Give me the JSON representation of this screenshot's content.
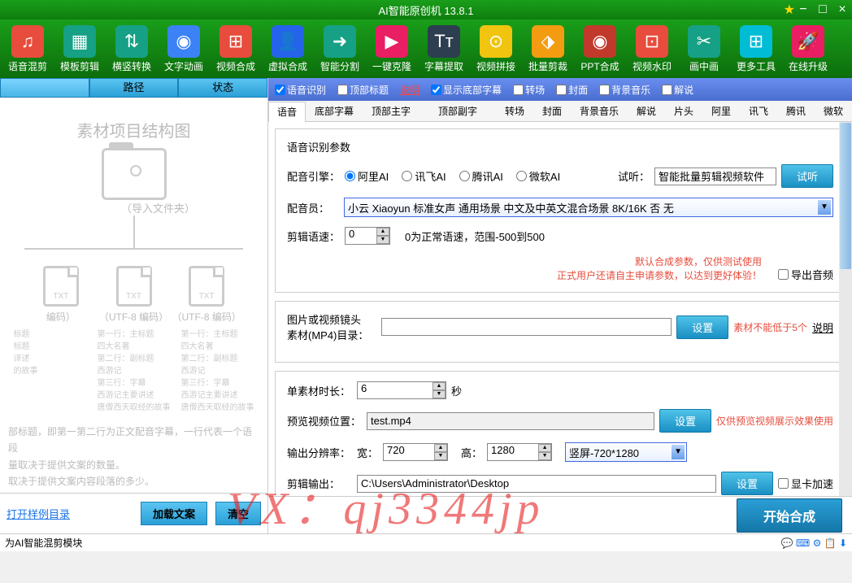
{
  "titlebar": {
    "title": "AI智能原创机 13.8.1"
  },
  "toolbar": [
    {
      "label": "语音混剪",
      "icon": "♫",
      "cls": "ic-red"
    },
    {
      "label": "模板剪辑",
      "icon": "▦",
      "cls": "ic-teal"
    },
    {
      "label": "横竖转换",
      "icon": "⇅",
      "cls": "ic-teal"
    },
    {
      "label": "文字动画",
      "icon": "◉",
      "cls": "ic-blue"
    },
    {
      "label": "视频合成",
      "icon": "⊞",
      "cls": "ic-red"
    },
    {
      "label": "虚拟合成",
      "icon": "👤",
      "cls": "ic-dblue"
    },
    {
      "label": "智能分割",
      "icon": "➜",
      "cls": "ic-teal"
    },
    {
      "label": "一键克隆",
      "icon": "▶",
      "cls": "ic-mag"
    },
    {
      "label": "字幕提取",
      "icon": "Tᴛ",
      "cls": "ic-dark"
    },
    {
      "label": "视频拼接",
      "icon": "⊙",
      "cls": "ic-yellow"
    },
    {
      "label": "批量剪裁",
      "icon": "⬗",
      "cls": "ic-orange"
    },
    {
      "label": "PPT合成",
      "icon": "◉",
      "cls": "ic-dred"
    },
    {
      "label": "视频水印",
      "icon": "⊡",
      "cls": "ic-red"
    },
    {
      "label": "画中画",
      "icon": "✂",
      "cls": "ic-teal"
    },
    {
      "label": "更多工具",
      "icon": "⊞",
      "cls": "ic-cyan"
    },
    {
      "label": "在线升级",
      "icon": "🚀",
      "cls": "ic-mag"
    }
  ],
  "left": {
    "tabs": [
      "",
      "路径",
      "状态"
    ],
    "diag_title": "素材项目结构图",
    "diag_import": "（导入文件夹）",
    "txt": "TXT",
    "enc": [
      "编码）",
      "（UTF-8 编码）",
      "（UTF-8 编码）"
    ],
    "samples": [
      [
        "标题",
        "第一行：主标题",
        "第一行：主标题"
      ],
      [
        "标题",
        "四大名著",
        "四大名著"
      ],
      [
        "",
        "第二行：副标题",
        "第二行：副标题"
      ],
      [
        "",
        "西游记",
        "西游记"
      ],
      [
        "译述",
        "第三行：字幕",
        "第三行：字幕"
      ],
      [
        "",
        "西游记主要讲述",
        "西游记主要讲述"
      ],
      [
        "的故事",
        "唐僧西天取经的故事",
        "唐僧西天取经的故事"
      ]
    ],
    "desc": [
      "部标题，即第一第二行为正文配音字幕，一行代表一个语段",
      "量取决于提供文案的数量。",
      "取决于提供文案内容段落的多少。"
    ],
    "open_sample": "打开样例目录",
    "load": "加载文案",
    "clear": "清空"
  },
  "opts": [
    {
      "label": "语音识别",
      "checked": true
    },
    {
      "label": "顶部标题",
      "checked": false,
      "link": "说明"
    },
    {
      "label": "显示底部字幕",
      "checked": true
    },
    {
      "label": "转场",
      "checked": false
    },
    {
      "label": "封面",
      "checked": false
    },
    {
      "label": "背景音乐",
      "checked": false
    },
    {
      "label": "解说",
      "checked": false
    }
  ],
  "subtabs": [
    "语音",
    "底部字幕",
    "顶部主字幕",
    "顶部副字幕",
    "转场",
    "封面",
    "背景音乐",
    "解说",
    "片头",
    "阿里",
    "讯飞",
    "腾讯",
    "微软"
  ],
  "voice": {
    "section_title": "语音识别参数",
    "engine_label": "配音引擎：",
    "engines": [
      "阿里AI",
      "讯飞AI",
      "腾讯AI",
      "微软AI"
    ],
    "engine_selected": 0,
    "try_label": "试听：",
    "try_value": "智能批量剪辑视频软件",
    "try_btn": "试听",
    "actor_label": "配音员：",
    "actor_value": "小云 Xiaoyun 标准女声 通用场景 中文及中英文混合场景 8K/16K 否 无",
    "speed_label": "剪辑语速：",
    "speed_value": "0",
    "speed_note": "0为正常语速，范围-500到500",
    "warn1": "默认合成参数，仅供测试使用",
    "warn2": "正式用户还请自主申请参数，以达到更好体验！",
    "export_audio": "导出音频"
  },
  "material": {
    "dir_label1": "图片或视频镜头",
    "dir_label2": "素材(MP4)目录：",
    "set_btn": "设置",
    "min_note": "素材不能低于5个",
    "desc_link": "说明",
    "single_label": "单素材时长：",
    "single_value": "6",
    "single_unit": "秒",
    "preview_label": "预览视频位置：",
    "preview_value": "test.mp4",
    "preview_note": "仅供预览视频展示效果使用",
    "res_label": "输出分辨率：",
    "width_label": "宽：",
    "width_value": "720",
    "height_label": "高：",
    "height_value": "1280",
    "orient_value": "竖屏-720*1280",
    "output_label": "剪辑输出：",
    "output_value": "C:\\Users\\Administrator\\Desktop",
    "gpu": "显卡加速"
  },
  "start_btn": "开始合成",
  "status": "为AI智能混剪模块",
  "watermark": "VX：qj3344jp"
}
